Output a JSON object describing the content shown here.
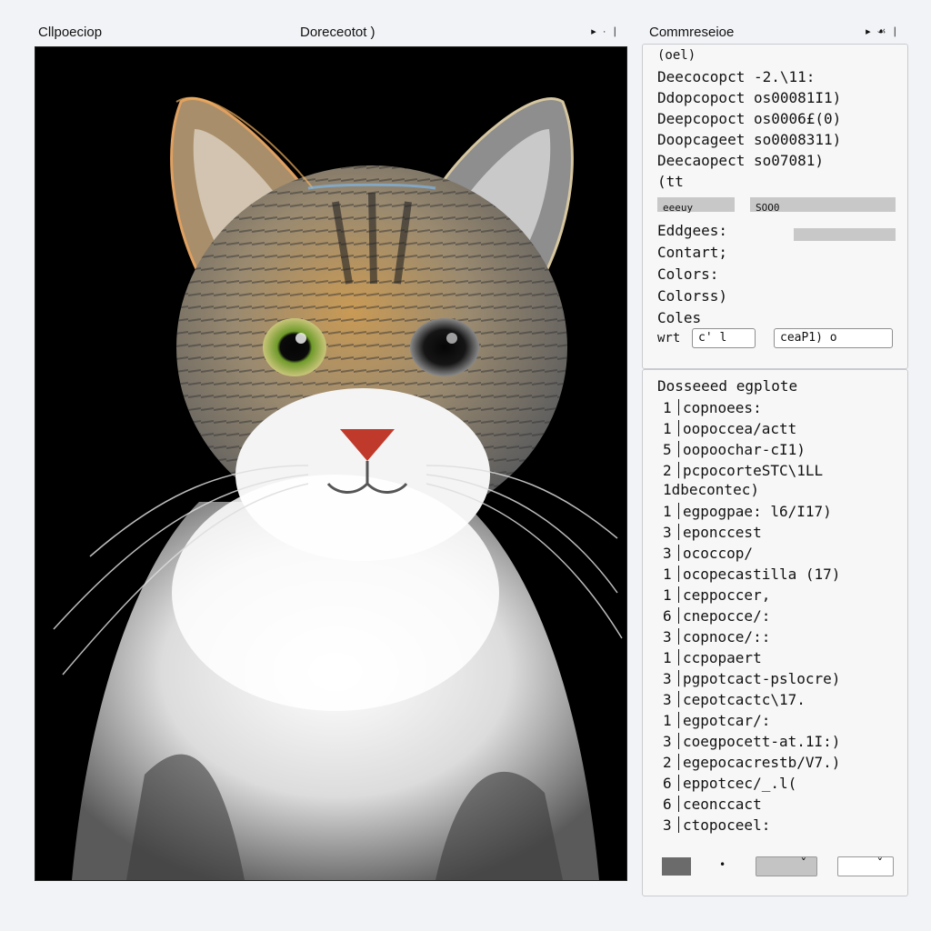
{
  "left_window": {
    "title": "Cllpoeciop",
    "center_title": "Doreceotot )"
  },
  "right_window": {
    "title": "Commreseioe"
  },
  "window_icons": [
    "play-icon",
    "dot-icon",
    "bar-icon"
  ],
  "settings": {
    "header": "(oel)",
    "items": [
      "Deecocopct -2.\\11:",
      "Ddopcopoct os00081I1)",
      "Deepcopoct os0006£(0)",
      "Doopcageet so0008311)",
      "Deecaopect so07081)"
    ],
    "section_label": "(tt",
    "slider_a_label": "eeeuy",
    "slider_b_label": "SOO0",
    "props": [
      "Eddgees:",
      "Contart;",
      "Colors:",
      "Colorss)",
      "Coles"
    ],
    "wrt_label": "wrt",
    "wrt_input": "c'  l",
    "mode_select": "ceaP1)  o"
  },
  "list_panel": {
    "title": "Dosseeed  egplote",
    "group1": [
      {
        "n": "1",
        "text": "copnoees:"
      },
      {
        "n": "1",
        "text": "oopoccea/actt"
      },
      {
        "n": "5",
        "text": "oopoochar-cI1)"
      },
      {
        "n": "2",
        "text": "pcpocorteSTC\\1LL"
      }
    ],
    "subheading": "1dbecontec)",
    "group2": [
      {
        "n": "1",
        "text": "egpogpae: l6/I17)"
      },
      {
        "n": "3",
        "text": "eponccest"
      },
      {
        "n": "3",
        "text": "ococcop/"
      },
      {
        "n": "1",
        "text": "ocopecastilla (17)"
      },
      {
        "n": "1",
        "text": "ceppoccer,"
      },
      {
        "n": "6",
        "text": "cnepocce/:"
      },
      {
        "n": "3",
        "text": "copnoce/::"
      },
      {
        "n": "1",
        "text": "ccpopaert"
      },
      {
        "n": "3",
        "text": "pgpotcact-pslocre)"
      },
      {
        "n": "3",
        "text": "cepotcactc\\17."
      },
      {
        "n": "1",
        "text": "egpotcar/:"
      },
      {
        "n": "3",
        "text": "coegpocett-at.1I:)"
      },
      {
        "n": "2",
        "text": "egepocacrestb/V7.)"
      },
      {
        "n": "6",
        "text": "eppotcec/_.l("
      },
      {
        "n": "6",
        "text": "ceonccact"
      },
      {
        "n": "3",
        "text": "ctopoceel:"
      }
    ],
    "footer_dot": "•",
    "footer_check_a": "ˇ",
    "footer_check_b": "ˇ"
  },
  "colors": {
    "swatch_dark": "#6b6b6b",
    "swatch_mid": "#c4c4c4",
    "swatch_light": "#ffffff"
  }
}
